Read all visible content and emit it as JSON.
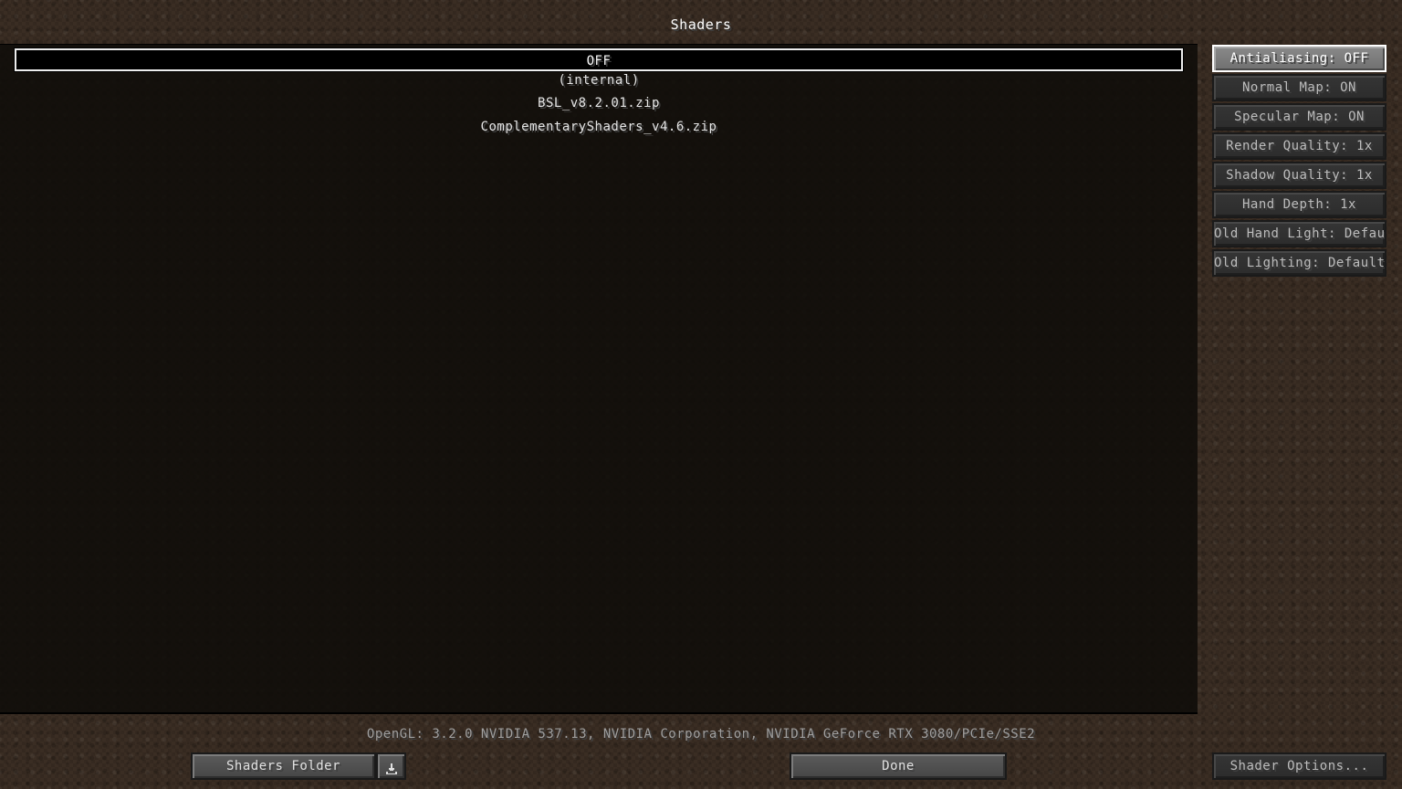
{
  "screen": {
    "title": "Shaders"
  },
  "shader_list": {
    "items": [
      {
        "label": "OFF",
        "selected": true
      },
      {
        "label": "(internal)",
        "selected": false
      },
      {
        "label": "BSL_v8.2.01.zip",
        "selected": false
      },
      {
        "label": "ComplementaryShaders_v4.6.zip",
        "selected": false
      }
    ]
  },
  "options": {
    "items": [
      {
        "label": "Antialiasing: OFF"
      },
      {
        "label": "Normal Map: ON"
      },
      {
        "label": "Specular Map: ON"
      },
      {
        "label": "Render Quality: 1x"
      },
      {
        "label": "Shadow Quality: 1x"
      },
      {
        "label": "Hand Depth: 1x"
      },
      {
        "label": "Old Hand Light: Default"
      },
      {
        "label": "Old Lighting: Default"
      }
    ],
    "shader_options_label": "Shader Options..."
  },
  "footer": {
    "gl_info": "OpenGL: 3.2.0 NVIDIA 537.13, NVIDIA Corporation, NVIDIA GeForce RTX 3080/PCIe/SSE2",
    "shaders_folder_label": "Shaders Folder",
    "download_icon": "download-icon",
    "done_label": "Done"
  }
}
